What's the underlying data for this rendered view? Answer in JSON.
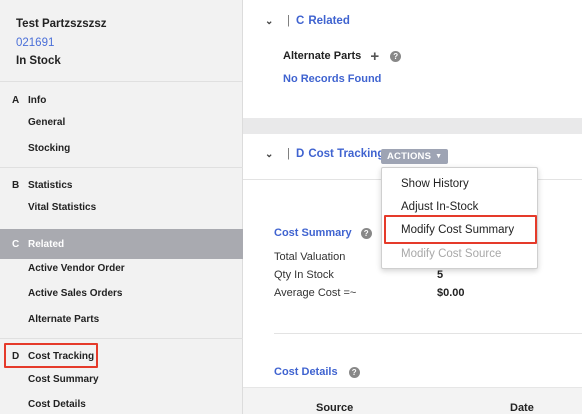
{
  "part": {
    "name": "Test Partzszszsz",
    "number": "021691",
    "status": "In Stock"
  },
  "sidebar": {
    "sections": [
      {
        "letter": "A",
        "label": "Info",
        "items": [
          "General",
          "Stocking"
        ]
      },
      {
        "letter": "B",
        "label": "Statistics",
        "items": [
          "Vital Statistics"
        ]
      },
      {
        "letter": "C",
        "label": "Related",
        "items": [
          "Active Vendor Order",
          "Active Sales Orders",
          "Alternate Parts"
        ]
      },
      {
        "letter": "D",
        "label": "Cost Tracking",
        "items": [
          "Cost Summary",
          "Cost Details"
        ]
      }
    ],
    "active_section": "C",
    "highlight_color": "#e53a2a"
  },
  "main": {
    "section_c": {
      "letter": "C",
      "title": "Related",
      "alternate_parts_label": "Alternate Parts",
      "no_records": "No Records Found"
    },
    "section_d": {
      "letter": "D",
      "title": "Cost Tracking",
      "actions_label": "ACTIONS",
      "actions_menu": [
        "Show History",
        "Adjust In-Stock",
        "Modify Cost Summary",
        "Modify Cost Source"
      ],
      "disabled_menu_item": "Modify Cost Source",
      "highlighted_menu_item": "Modify Cost Summary",
      "cost_summary_label": "Cost Summary",
      "summary_rows": [
        {
          "label": "Total Valuation",
          "value": ""
        },
        {
          "label": "Qty In Stock",
          "value": "5"
        },
        {
          "label": "Average Cost =~",
          "value": "$0.00"
        }
      ],
      "cost_details_label": "Cost Details",
      "table_columns": [
        "Source",
        "Date"
      ]
    }
  },
  "colors": {
    "link": "#3f63d0",
    "active_nav": "#a9aab0",
    "actions_btn": "#9ea4b4"
  }
}
